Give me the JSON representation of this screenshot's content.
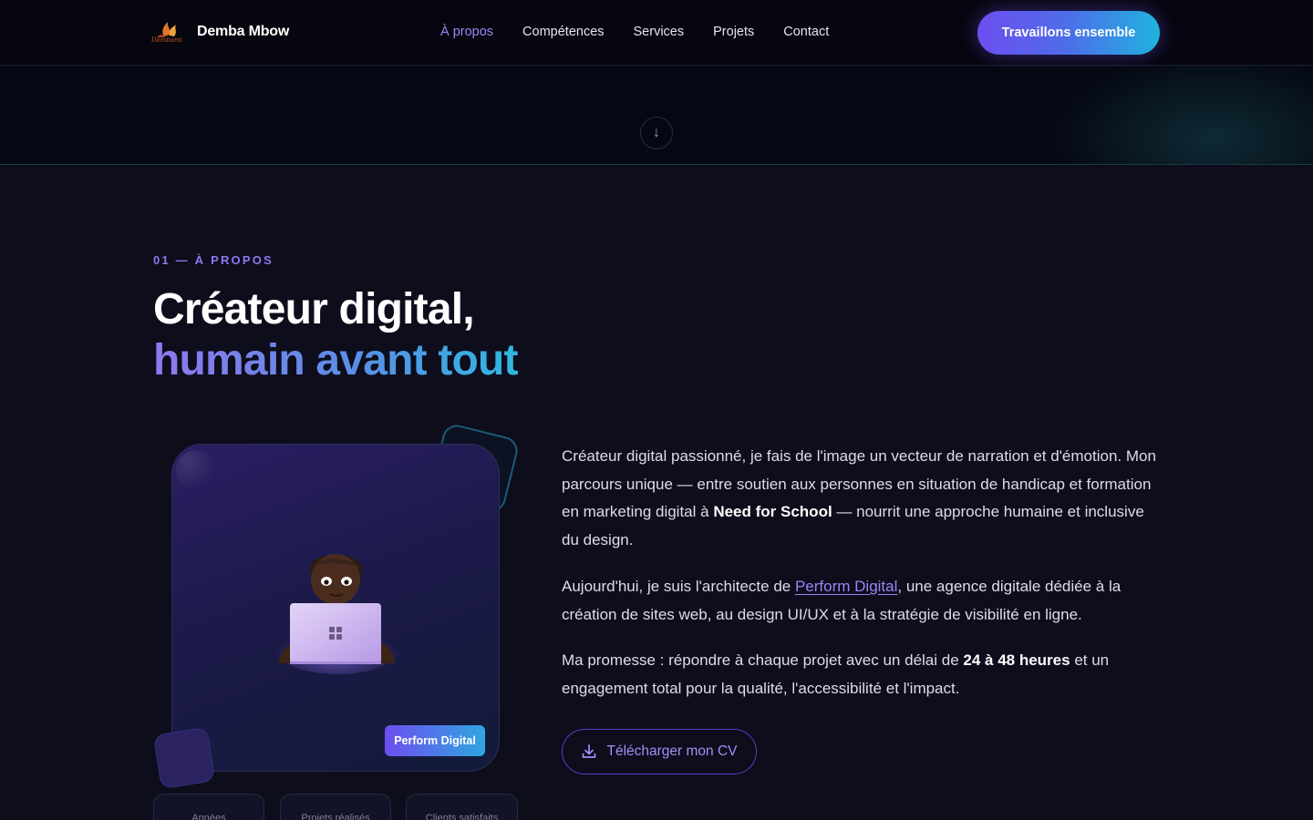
{
  "nav": {
    "brand": "Demba Mbow",
    "logo_text": "Dembami",
    "links": [
      "À propos",
      "Compétences",
      "Services",
      "Projets",
      "Contact"
    ],
    "active_index": 0,
    "cta": "Travaillons ensemble"
  },
  "hero": {
    "scroll_icon": "↓"
  },
  "about": {
    "eyebrow": "01 — À PROPOS",
    "title_line1": "Créateur digital,",
    "title_line2": "humain avant tout",
    "badge": "Perform Digital",
    "stats": [
      "Années",
      "Projets réalisés",
      "Clients satisfaits"
    ],
    "p1_a": "Créateur digital passionné, je fais de l'image un vecteur de narration et d'émotion. Mon parcours unique — entre soutien aux personnes en situation de handicap et formation en marketing digital à ",
    "p1_b": "Need for School",
    "p1_c": " — nourrit une approche humaine et inclusive du design.",
    "p2_a": "Aujourd'hui, je suis l'architecte de ",
    "p2_link": "Perform Digital",
    "p2_b": ", une agence digitale dédiée à la création de sites web, au design UI/UX et à la stratégie de visibilité en ligne.",
    "p3_a": "Ma promesse : répondre à chaque projet avec un délai de ",
    "p3_b": "24 à 48 heures",
    "p3_c": " et un engagement total pour la qualité, l'accessibilité et l'impact.",
    "cv_button": "Télécharger mon CV"
  },
  "colors": {
    "accent_purple": "#8f78ee",
    "accent_cyan": "#2fb8df",
    "background": "#0d0d1c"
  },
  "icons": [
    "logo-mark-icon",
    "arrow-down-icon",
    "download-icon",
    "windows-logo-icon"
  ]
}
